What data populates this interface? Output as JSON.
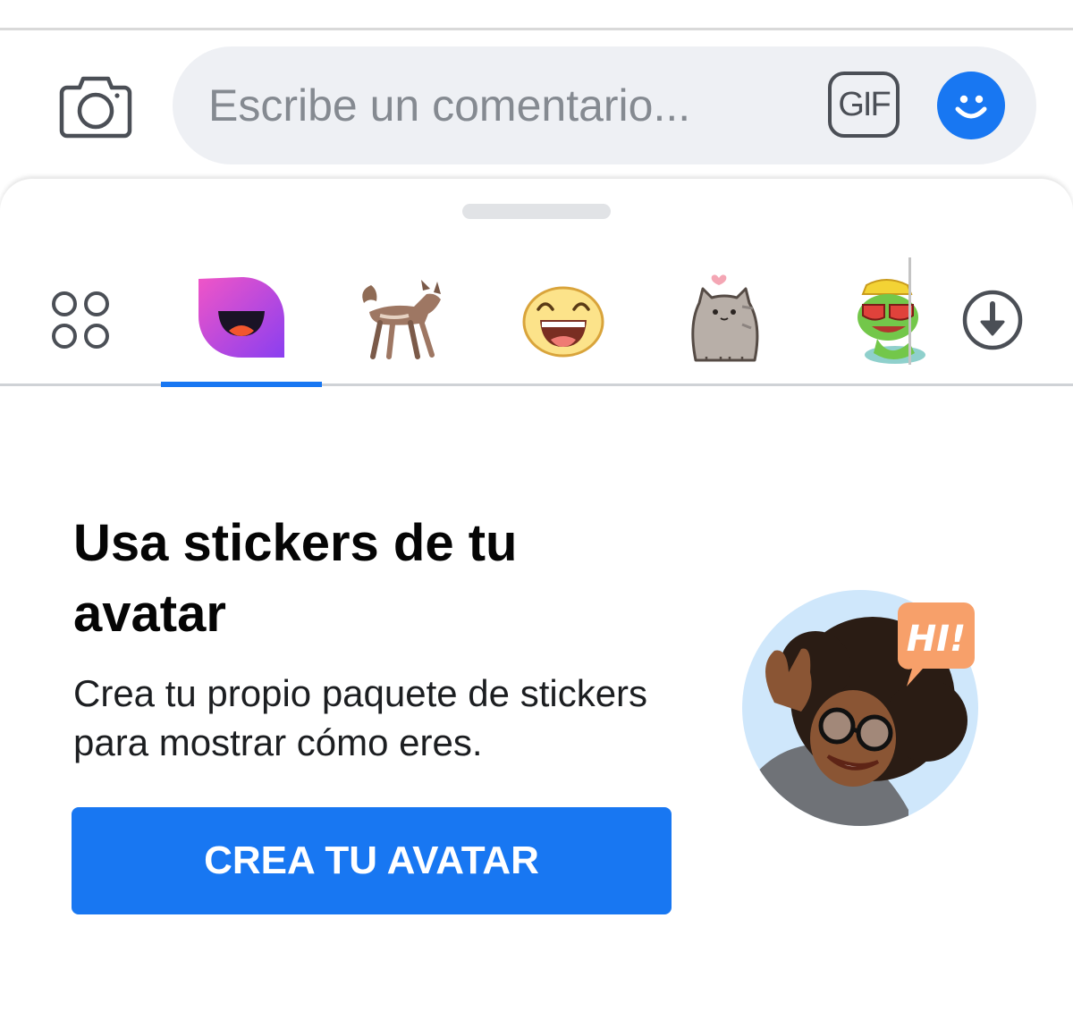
{
  "composer": {
    "placeholder": "Escribe un comentario...",
    "camera_icon": "camera-icon",
    "gif_label": "GIF",
    "emoji_icon": "smiley-icon"
  },
  "sticker_tabs": [
    {
      "name": "grid-icon",
      "selected": false
    },
    {
      "name": "avatar-sticker-pack-icon",
      "selected": true
    },
    {
      "name": "fox-sticker-pack-icon",
      "selected": false
    },
    {
      "name": "laughing-face-sticker-pack-icon",
      "selected": false
    },
    {
      "name": "pusheen-cat-sticker-pack-icon",
      "selected": false
    },
    {
      "name": "frog-sunglasses-sticker-pack-icon",
      "selected": false
    },
    {
      "name": "download-icon",
      "selected": false
    }
  ],
  "promo": {
    "title_line1": "Usa stickers de tu",
    "title_line2": "avatar",
    "body_line1": "Crea tu propio paquete de stickers",
    "body_line2": "para mostrar cómo eres.",
    "cta_label": "CREA TU AVATAR",
    "illustration_bubble": "HI!"
  },
  "colors": {
    "accent": "#1877f2",
    "composer_bg": "#eef0f4",
    "title_text": "#050505",
    "bubble": "#f7a06a"
  }
}
